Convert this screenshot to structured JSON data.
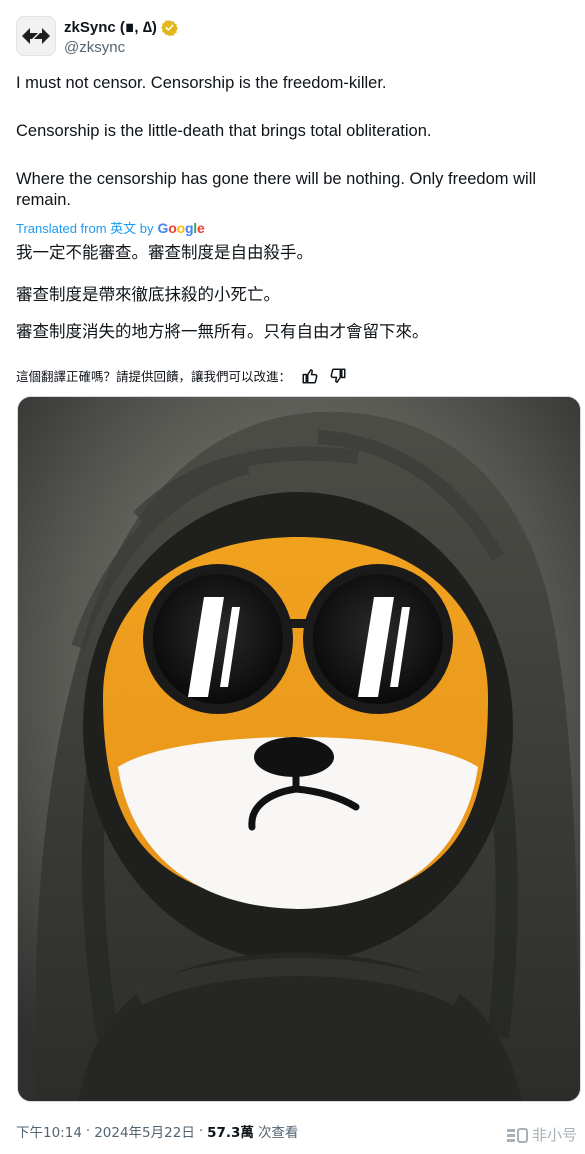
{
  "author": {
    "display_name": "zkSync (∎, ∆)",
    "handle": "@zksync",
    "avatar_icon": "zksync-arrows-logo",
    "verified_color": "#e2b719"
  },
  "tweet": {
    "paragraphs_en": [
      "I must not censor. Censorship is the freedom-killer.",
      "Censorship is the little-death that brings total obliteration.",
      "Where the censorship has gone there will be nothing. Only freedom will remain."
    ],
    "translated_label": "Translated from 英文 by",
    "google_letters": [
      "G",
      "o",
      "o",
      "g",
      "l",
      "e"
    ],
    "paragraphs_zh": [
      "我一定不能審查。審查制度是自由殺手。",
      "審查制度是帶來徹底抹殺的小死亡。",
      "審查制度消失的地方將一無所有。只有自由才會留下來。"
    ],
    "feedback_prompt": "這個翻譯正確嗎？請提供回饋，讓我們可以改進：",
    "feedback_icons": [
      "thumbs-up-icon",
      "thumbs-down-icon"
    ]
  },
  "media": {
    "description_icon": "hooded-shiba-mask-photo"
  },
  "meta": {
    "time": "下午10:14",
    "separator": "·",
    "date": "2024年5月22日",
    "separator2": "·",
    "views_count": "57.3萬",
    "views_label": "次查看"
  },
  "watermark": {
    "text": "非小号"
  },
  "colors": {
    "link": "#1d9bf0",
    "text": "#0f1419",
    "muted": "#536471"
  }
}
